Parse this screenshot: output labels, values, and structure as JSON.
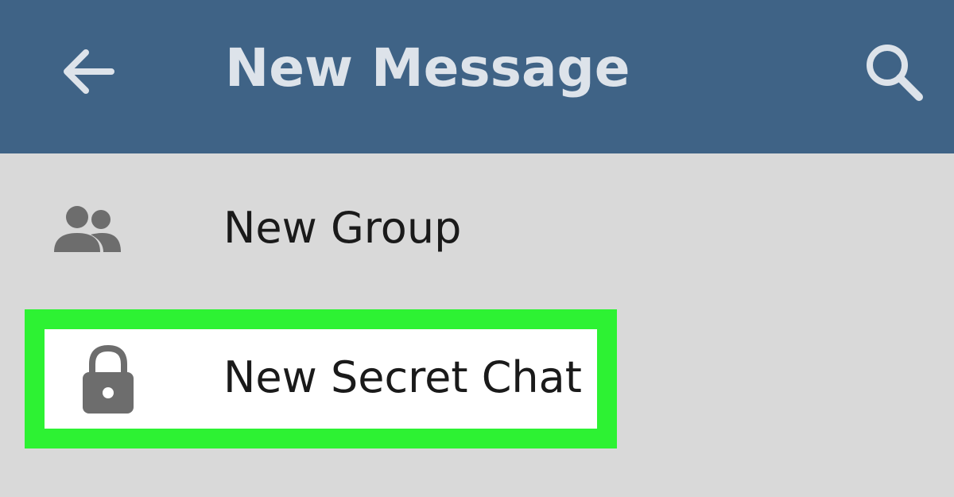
{
  "header": {
    "title": "New Message",
    "back_icon": "arrow-left-icon",
    "search_icon": "search-icon",
    "background": "#3f6386",
    "title_color": "#dde3ea"
  },
  "menu": {
    "items": [
      {
        "label": "New Group",
        "icon": "group-icon"
      },
      {
        "label": "New Secret Chat",
        "icon": "lock-icon",
        "highlighted": true
      }
    ]
  },
  "colors": {
    "content_bg": "#d9d9d9",
    "highlight": "#2df233",
    "icon": "#6d6d6d"
  }
}
